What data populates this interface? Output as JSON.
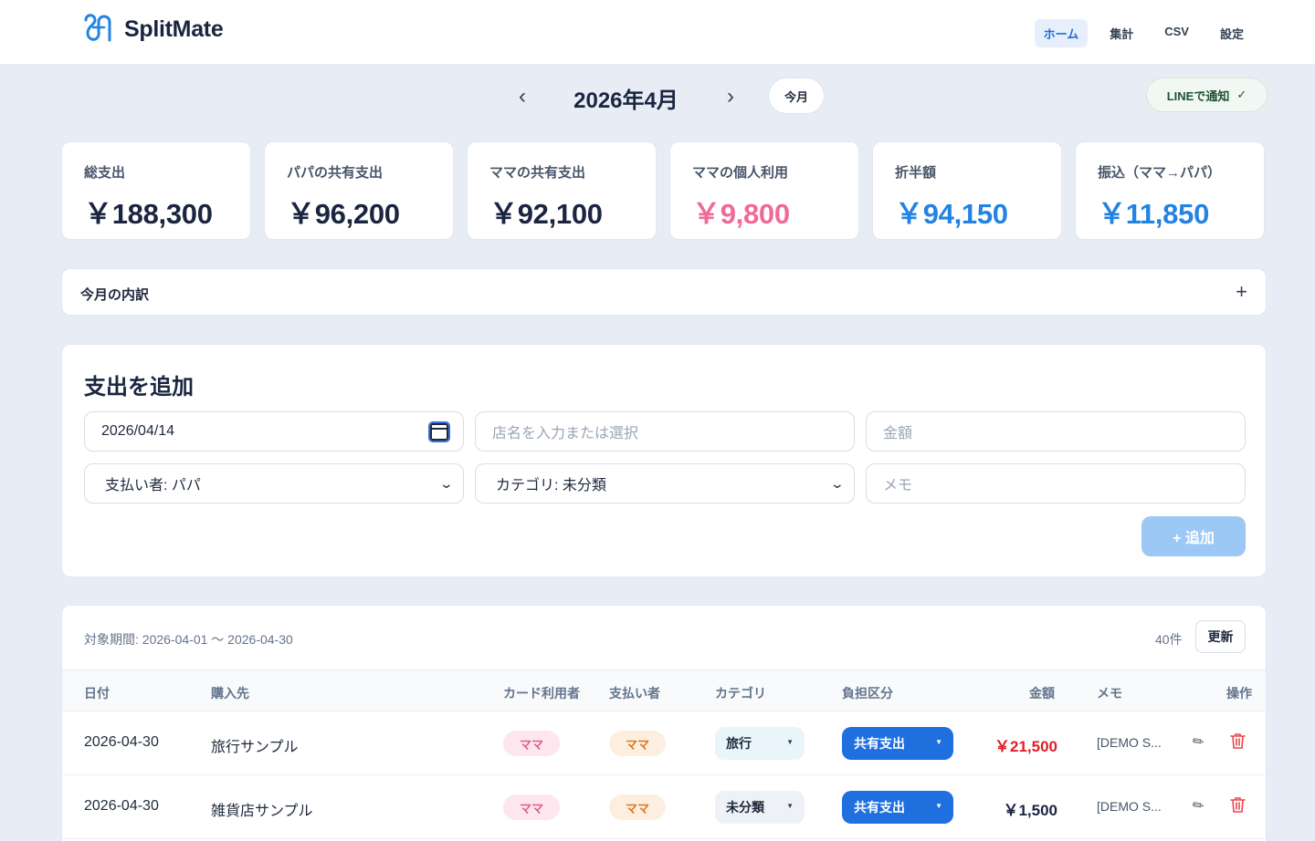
{
  "app": {
    "name": "SplitMate",
    "brand_color": "#2383e2"
  },
  "nav": {
    "items": [
      {
        "label": "ホーム",
        "active": true
      },
      {
        "label": "集計",
        "active": false
      },
      {
        "label": "CSV",
        "active": false
      },
      {
        "label": "設定",
        "active": false
      }
    ]
  },
  "month_bar": {
    "prev": "‹",
    "title": "2026年4月",
    "next": "›",
    "today_label": "今月",
    "line_label": "LINEで通知",
    "line_check": "✓"
  },
  "summary": [
    {
      "label": "総支出",
      "value": "￥188,300",
      "tone": "default"
    },
    {
      "label": "パパの共有支出",
      "value": "￥96,200",
      "tone": "default"
    },
    {
      "label": "ママの共有支出",
      "value": "￥92,100",
      "tone": "default"
    },
    {
      "label": "ママの個人利用",
      "value": "￥9,800",
      "tone": "pink"
    },
    {
      "label": "折半額",
      "value": "￥94,150",
      "tone": "blue"
    },
    {
      "label": "振込（ママ→パパ）",
      "value": "￥11,850",
      "tone": "blue"
    }
  ],
  "breakdown": {
    "title": "今月の内訳",
    "toggle": "+"
  },
  "add_expense": {
    "title": "支出を追加",
    "date_value": "2026/04/14",
    "store_placeholder": "店名を入力または選択",
    "amount_placeholder": "金額",
    "payer_value": "支払い者: パパ",
    "category_value": "カテゴリ: 未分類",
    "memo_placeholder": "メモ",
    "submit_label": "+ 追加"
  },
  "list": {
    "period": "対象期間: 2026-04-01 〜 2026-04-30",
    "count": "40件",
    "refresh_label": "更新",
    "headers": {
      "date": "日付",
      "store": "購入先",
      "card_user": "カード利用者",
      "payer": "支払い者",
      "category": "カテゴリ",
      "share": "負担区分",
      "amount": "金額",
      "memo": "メモ",
      "actions": "操作"
    },
    "rows": [
      {
        "date": "2026-04-30",
        "store": "旅行サンプル",
        "card_user": "ママ",
        "payer": "ママ",
        "category": "旅行",
        "category_bg": "#e9f5fb",
        "share": "共有支出",
        "amount": "￥21,500",
        "amount_color": "#e11d2a",
        "memo": "[DEMO S..."
      },
      {
        "date": "2026-04-30",
        "store": "雑貨店サンプル",
        "card_user": "ママ",
        "payer": "ママ",
        "category": "未分類",
        "category_bg": "#eef1f5",
        "share": "共有支出",
        "amount": "￥1,500",
        "amount_color": "#1a2540",
        "memo": "[DEMO S..."
      }
    ]
  }
}
